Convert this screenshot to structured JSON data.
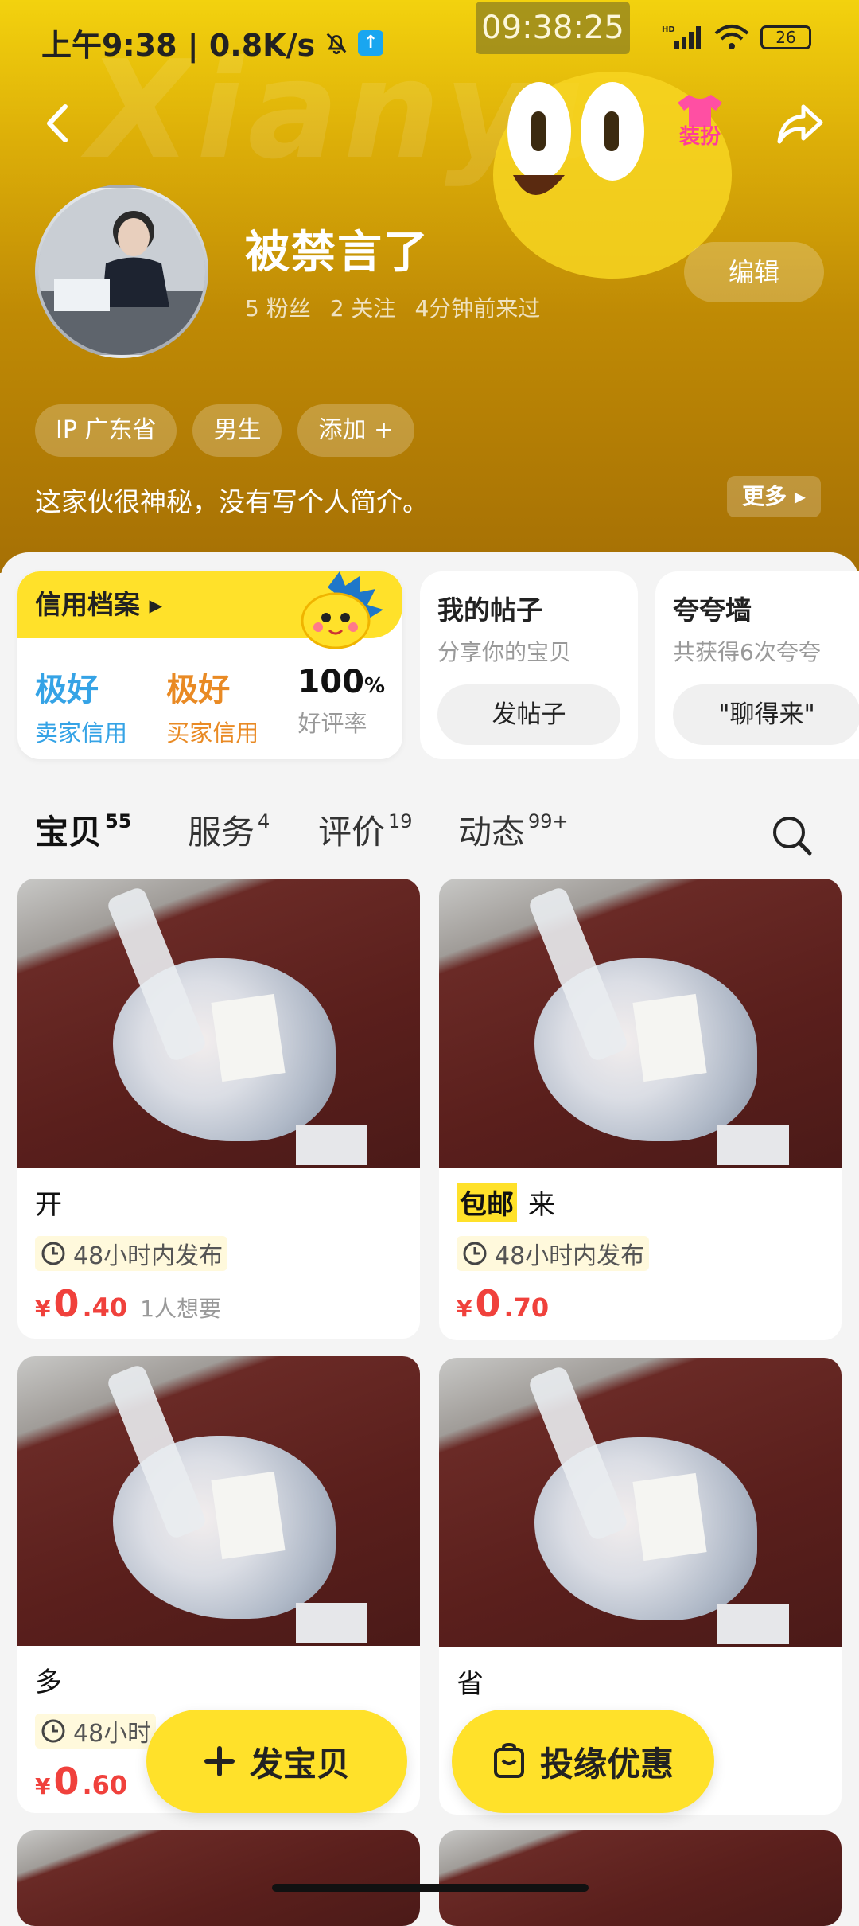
{
  "status_bar": {
    "left_text": "上午9:38 | 0.8K/s",
    "center_time": "09:38:25",
    "battery": "26"
  },
  "header": {
    "dress_label": "装扮",
    "username": "被禁言了",
    "stats": [
      "5 粉丝",
      "2 关注",
      "4分钟前来过"
    ],
    "edit_label": "编辑",
    "tags": [
      "IP 广东省",
      "男生",
      "添加 +"
    ],
    "bio": "这家伙很神秘，没有写个人简介。",
    "more_label": "更多 ▸"
  },
  "credit": {
    "title": "信用档案 ▸",
    "seller_value": "极好",
    "seller_label": "卖家信用",
    "buyer_value": "极好",
    "buyer_label": "买家信用",
    "rate_value": "100",
    "rate_unit": "%",
    "rate_label": "好评率"
  },
  "posts_card": {
    "title": "我的帖子",
    "subtitle": "分享你的宝贝",
    "button": "发帖子"
  },
  "praise_card": {
    "title": "夸夸墙",
    "subtitle": "共获得6次夸夸",
    "button": "\"聊得来\""
  },
  "tabs": [
    {
      "label": "宝贝",
      "count": "55"
    },
    {
      "label": "服务",
      "count": "4"
    },
    {
      "label": "评价",
      "count": "19"
    },
    {
      "label": "动态",
      "count": "99+"
    }
  ],
  "items": [
    {
      "badge": "",
      "title": "开",
      "time": "48小时内发布",
      "price_int": "0",
      "price_dec": ".40",
      "want": "1人想要"
    },
    {
      "badge": "包邮",
      "title": "来",
      "time": "48小时内发布",
      "price_int": "0",
      "price_dec": ".70",
      "want": ""
    },
    {
      "badge": "",
      "title": "多",
      "time": "48小时",
      "price_int": "0",
      "price_dec": ".60",
      "want": ""
    },
    {
      "badge": "",
      "title": "省",
      "time": "",
      "price_int": "",
      "price_dec": "",
      "want": ""
    }
  ],
  "currency": "¥",
  "fab": {
    "post_label": "发宝贝",
    "promo_label": "投缘优惠"
  }
}
